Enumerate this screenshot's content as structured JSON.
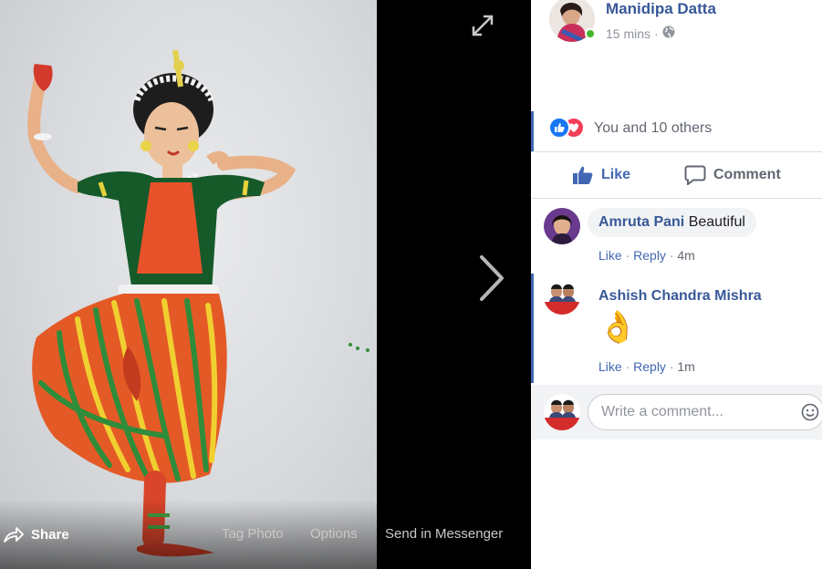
{
  "viewer": {
    "actions": {
      "share_label": "Share",
      "tag_photo_label": "Tag Photo",
      "options_label": "Options",
      "send_messenger_label": "Send in Messenger"
    },
    "icons": [
      "expand-icon",
      "next-arrow-icon",
      "share-icon"
    ]
  },
  "post": {
    "author_name": "Manidipa Datta",
    "timestamp": "15 mins",
    "separator": "·",
    "privacy_icon": "globe-icon",
    "author_online": true
  },
  "reactions": {
    "icons": [
      "like-reaction-icon",
      "love-reaction-icon"
    ],
    "summary": "You and 10 others"
  },
  "actions": {
    "like_label": "Like",
    "comment_label": "Comment"
  },
  "comments": [
    {
      "author": "Amruta Pani",
      "text": "Beautiful",
      "like_label": "Like",
      "reply_label": "Reply",
      "age": "4m"
    },
    {
      "author": "Ashish Chandra Mishra",
      "text": "👌",
      "like_label": "Like",
      "reply_label": "Reply",
      "age": "1m"
    }
  ],
  "composer": {
    "placeholder": "Write a comment...",
    "emoji_icon": "smiley-icon"
  },
  "colors": {
    "link_blue": "#385898",
    "accent_blue": "#4267b2",
    "meta_gray": "#90949c",
    "online_green": "#42b72a",
    "love_red": "#f33e58"
  }
}
